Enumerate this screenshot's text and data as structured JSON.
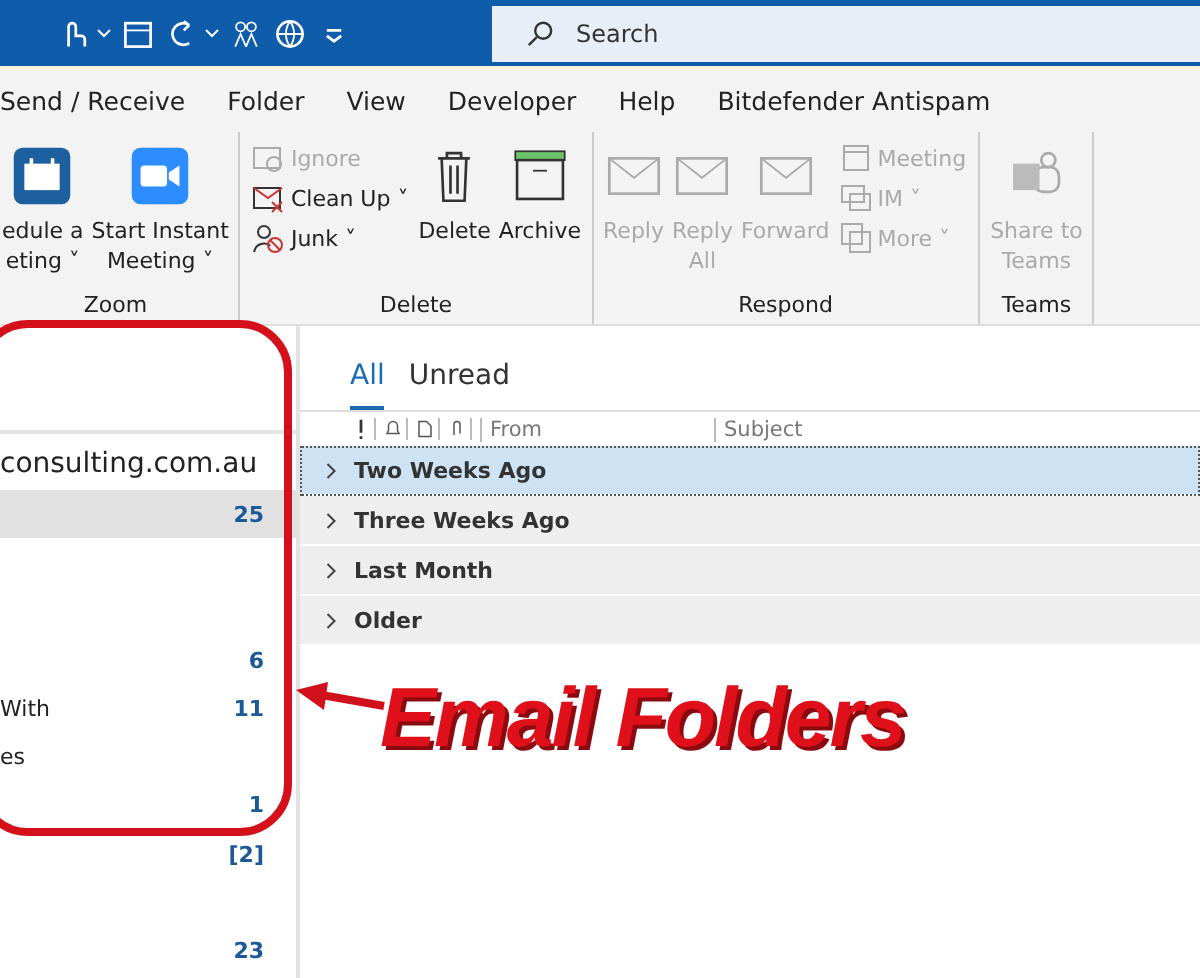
{
  "search": {
    "placeholder": "Search"
  },
  "menu_tabs": [
    {
      "label": "Send / Receive"
    },
    {
      "label": "Folder"
    },
    {
      "label": "View"
    },
    {
      "label": "Developer"
    },
    {
      "label": "Help"
    },
    {
      "label": "Bitdefender Antispam"
    }
  ],
  "ribbon_groups": [
    {
      "label": "Zoom",
      "items": [
        {
          "kind": "large",
          "lines": [
            "edule a",
            "eting ˅"
          ],
          "disabled": false
        },
        {
          "kind": "large",
          "lines": [
            "Start Instant",
            "Meeting ˅"
          ],
          "disabled": false
        }
      ]
    },
    {
      "label": "Delete",
      "items": [
        {
          "kind": "stack",
          "rows": [
            {
              "label": "Ignore",
              "disabled": true
            },
            {
              "label": "Clean Up ˅",
              "disabled": false
            },
            {
              "label": "Junk ˅",
              "disabled": false
            }
          ]
        },
        {
          "kind": "large",
          "lines": [
            "Delete"
          ],
          "disabled": false
        },
        {
          "kind": "large",
          "lines": [
            "Archive"
          ],
          "disabled": false
        }
      ]
    },
    {
      "label": "Respond",
      "items": [
        {
          "kind": "large",
          "lines": [
            "Reply"
          ],
          "disabled": true
        },
        {
          "kind": "large",
          "lines": [
            "Reply",
            "All"
          ],
          "disabled": true
        },
        {
          "kind": "large",
          "lines": [
            "Forward"
          ],
          "disabled": true
        },
        {
          "kind": "stack",
          "rows": [
            {
              "label": "Meeting",
              "disabled": true
            },
            {
              "label": "IM ˅",
              "disabled": true
            },
            {
              "label": "More ˅",
              "disabled": true
            }
          ]
        }
      ]
    },
    {
      "label": "Teams",
      "items": [
        {
          "kind": "large",
          "lines": [
            "Share to",
            "Teams"
          ],
          "disabled": true
        }
      ]
    }
  ],
  "folder_pane": {
    "account": "consulting.com.au",
    "folders": [
      {
        "count": "25",
        "selected": true
      },
      {
        "selected": false
      },
      {
        "selected": false
      },
      {
        "count": "6",
        "selected": false
      },
      {
        "label": "With",
        "count": "11",
        "selected": false
      },
      {
        "label": "es",
        "selected": false
      },
      {
        "count": "1",
        "selected": false
      },
      {
        "count": "[2]",
        "selected": false
      },
      {
        "selected": false
      },
      {
        "count": "23",
        "selected": false
      }
    ]
  },
  "message_list": {
    "filters": [
      {
        "label": "All",
        "selected": true
      },
      {
        "label": "Unread",
        "selected": false
      }
    ],
    "columns": [
      "From",
      "Subject"
    ],
    "groups": [
      {
        "label": "Two Weeks Ago",
        "selected": true
      },
      {
        "label": "Three Weeks Ago",
        "selected": false
      },
      {
        "label": "Last Month",
        "selected": false
      },
      {
        "label": "Older",
        "selected": false
      }
    ]
  },
  "annotation": {
    "text": "Email Folders"
  }
}
